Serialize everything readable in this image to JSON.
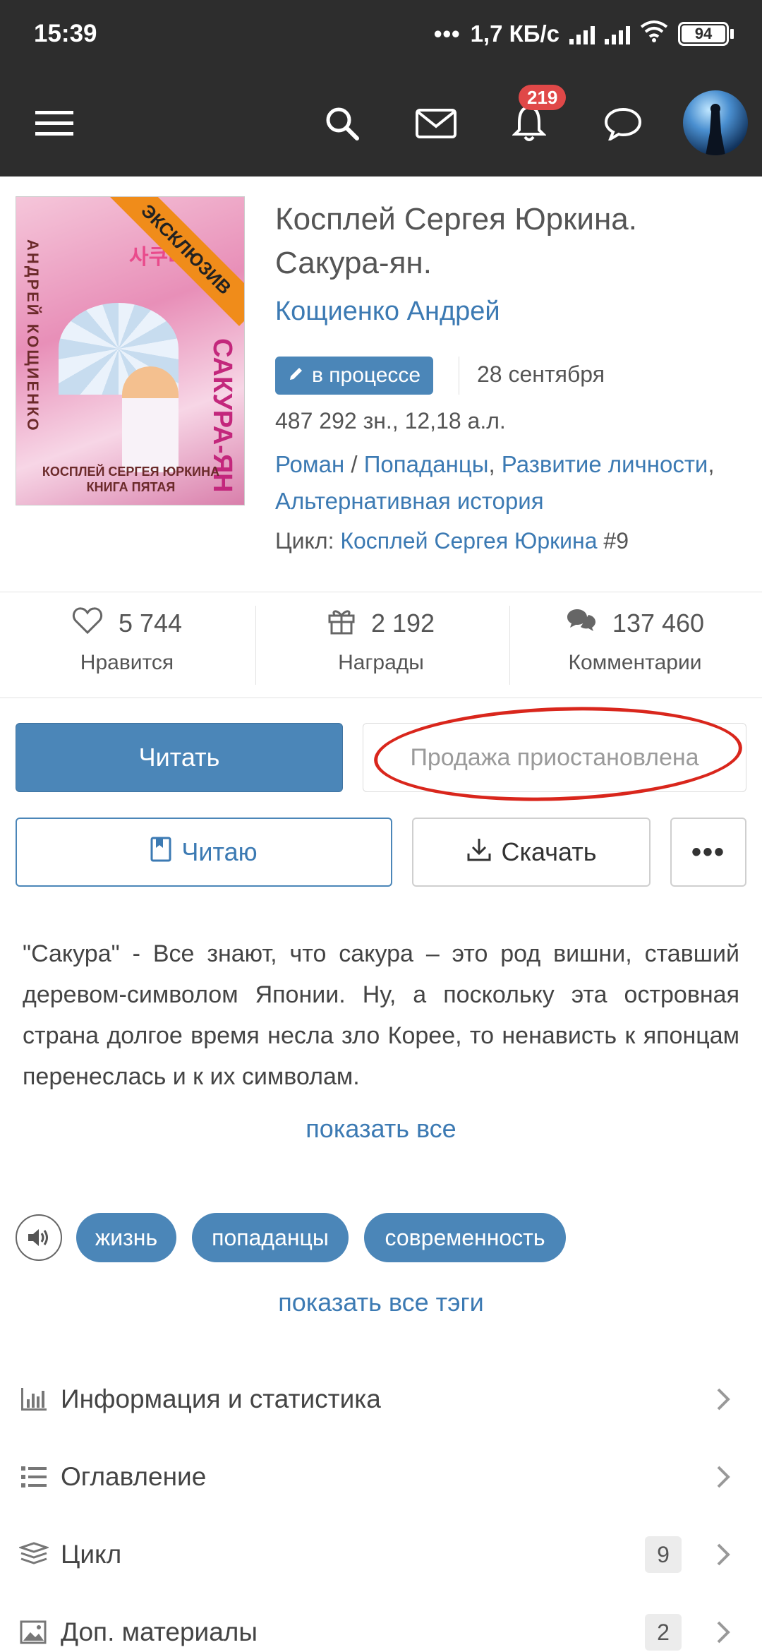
{
  "status_bar": {
    "time": "15:39",
    "network": "1,7 КБ/с",
    "battery": "94"
  },
  "toolbar": {
    "notification_count": "219"
  },
  "book": {
    "cover": {
      "ribbon": "ЭКСКЛЮЗИВ",
      "side_text": "АНДРЕЙ КОЩИЕНКО",
      "title_vertical": "САКУРА-ЯН",
      "bottom_text": "КОСПЛЕЙ СЕРГЕЯ ЮРКИНА КНИГА ПЯТАЯ",
      "kana": "사쿠라"
    },
    "title": "Косплей Сергея Юркина. Сакура-ян.",
    "author": "Кощиенко Андрей",
    "status": "в процессе",
    "date": "28 сентября",
    "size": "487 292 зн., 12,18 а.л.",
    "genre_main": "Роман",
    "genre_sep": " / ",
    "genres": [
      "Попаданцы",
      "Развитие личности",
      "Альтернативная история"
    ],
    "cycle_label": "Цикл:",
    "cycle_name": "Косплей Сергея Юркина",
    "cycle_number": "#9"
  },
  "stats": {
    "likes": {
      "value": "5 744",
      "label": "Нравится"
    },
    "awards": {
      "value": "2 192",
      "label": "Награды"
    },
    "comments": {
      "value": "137 460",
      "label": "Комментарии"
    }
  },
  "actions": {
    "read": "Читать",
    "sale": "Продажа приостановлена",
    "reading": "Читаю",
    "download": "Скачать"
  },
  "annotation": {
    "text": "\"Сакура\" - Все знают, что сакура – это род вишни, ставший деревом-символом Японии. Ну, а поскольку эта островная страна долгое время несла зло Корее, то ненависть к японцам перенеслась и к их символам.",
    "show_all": "показать все"
  },
  "tags": {
    "items": [
      "жизнь",
      "попаданцы",
      "современность"
    ],
    "show_all": "показать все тэги"
  },
  "menu": [
    {
      "label": "Информация и статистика",
      "count": ""
    },
    {
      "label": "Оглавление",
      "count": ""
    },
    {
      "label": "Цикл",
      "count": "9"
    },
    {
      "label": "Доп. материалы",
      "count": "2"
    }
  ],
  "colors": {
    "accent": "#4b86b8",
    "link": "#3c7ab3",
    "topbar": "#2d2d2d",
    "badge": "#e04848",
    "highlight": "#d9261c"
  }
}
